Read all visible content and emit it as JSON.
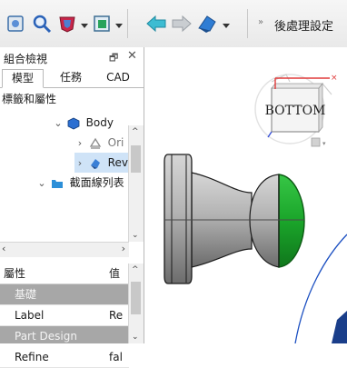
{
  "toolbar": {
    "workbench_label": "後處理設定",
    "overflow_glyph": "»",
    "buttons": [
      "view-icon",
      "zoom-icon",
      "draw-style-icon",
      "selection-filter-icon",
      "back-arrow-icon",
      "forward-arrow-icon",
      "workbench-icon"
    ]
  },
  "combo_view": {
    "title": "組合檢視",
    "float_glyph": "🗗",
    "close_glyph": "✕",
    "tabs": [
      "模型",
      "任務",
      "CAD"
    ],
    "active_tab": "模型"
  },
  "tree": {
    "header": "標籤和屬性",
    "items": [
      {
        "label": "Body",
        "depth": 1,
        "expanded": true,
        "icon": "body-icon"
      },
      {
        "label": "Ori",
        "depth": 2,
        "expanded": false,
        "icon": "origin-icon"
      },
      {
        "label": "Rev",
        "depth": 2,
        "expanded": false,
        "icon": "revolution-icon",
        "selected": true
      },
      {
        "label": "截面線列表",
        "depth": 0,
        "expanded": true,
        "icon": "folder-icon"
      }
    ]
  },
  "properties": {
    "col_property": "屬性",
    "col_value": "值",
    "rows": [
      {
        "type": "group",
        "label": "基礎"
      },
      {
        "type": "prop",
        "label": "Label",
        "value": "Re"
      },
      {
        "type": "group",
        "label": "Part Design"
      },
      {
        "type": "prop",
        "label": "Refine",
        "value": "fal"
      }
    ]
  },
  "navcube": {
    "face_label": "BOTTOM"
  },
  "colors": {
    "accent_green": "#1aa52a",
    "part_gray": "#9a9a9a",
    "navcube_red": "#e03a3a",
    "navcube_blue": "#3a52d8",
    "selection_blue": "#cfe3f7"
  }
}
